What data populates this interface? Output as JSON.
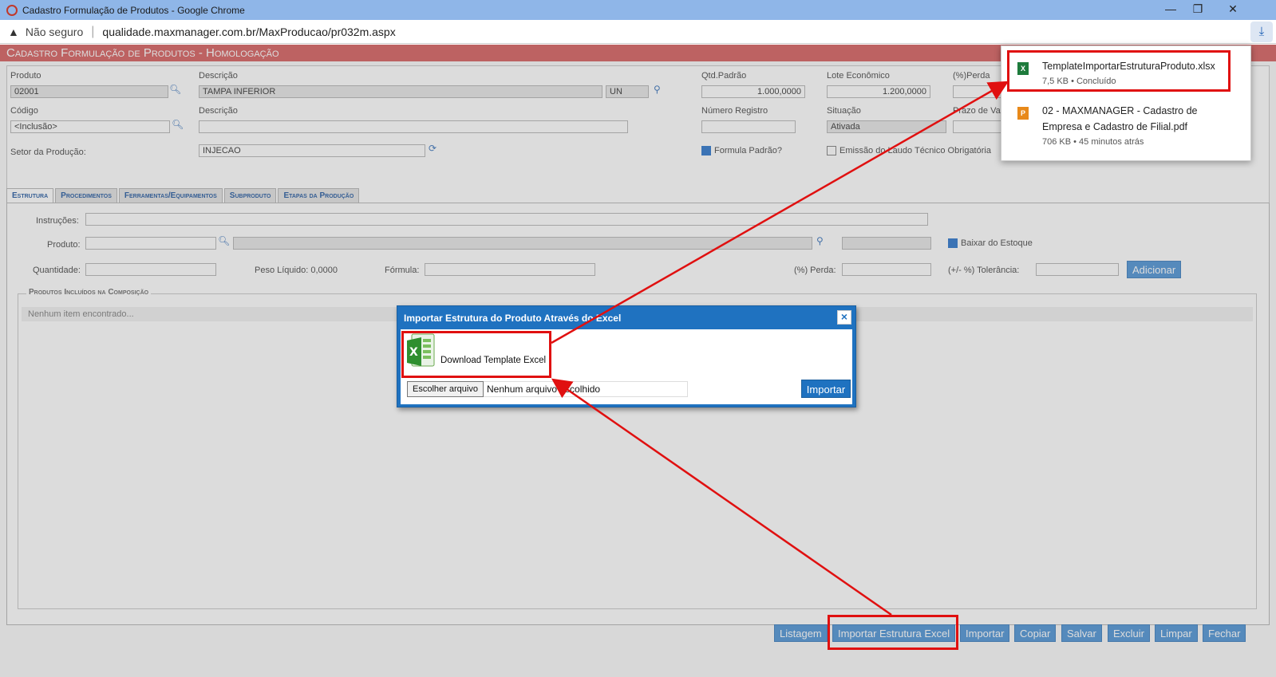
{
  "browser": {
    "window_title": "Cadastro Formulação de Produtos - Google Chrome",
    "security_label": "Não seguro",
    "url": "qualidade.maxmanager.com.br/MaxProducao/pr032m.aspx"
  },
  "page": {
    "title": "Cadastro Formulação de Produtos - Homologação"
  },
  "form": {
    "produto_label": "Produto",
    "produto_value": "02001",
    "descricao_label": "Descrição",
    "descricao_value": "TAMPA INFERIOR",
    "unidade_value": "UN",
    "qtd_padrao_label": "Qtd.Padrão",
    "qtd_padrao_value": "1.000,0000",
    "lote_economico_label": "Lote Econômico",
    "lote_economico_value": "1.200,0000",
    "perda_label": "(%)Perda",
    "codigo_label": "Código",
    "codigo_value": "<Inclusão>",
    "descricao2_label": "Descrição",
    "numero_registro_label": "Número Registro",
    "situacao_label": "Situação",
    "situacao_value": "Ativada",
    "prazo_label": "Prazo de Va",
    "setor_label": "Setor da Produção:",
    "setor_value": "INJECAO",
    "formula_padrao_label": "Formula Padrão?",
    "emissao_laudo_label": "Emissão do Laudo Técnico Obrigatória"
  },
  "tabs": [
    {
      "label": "Estrutura"
    },
    {
      "label": "Procedimentos"
    },
    {
      "label": "Ferramentas/Equipamentos"
    },
    {
      "label": "Subproduto"
    },
    {
      "label": "Etapas da Produção"
    }
  ],
  "estrutura": {
    "instrucoes_label": "Instruções:",
    "produto_label": "Produto:",
    "baixar_estoque_label": "Baixar do Estoque",
    "quantidade_label": "Quantidade:",
    "peso_liquido": "Peso Líquido: 0,0000",
    "formula_label": "Fórmula:",
    "perda_label": "(%) Perda:",
    "tolerancia_label": "(+/- %) Tolerância:",
    "adicionar_label": "Adicionar",
    "produtos_legend": "Produtos Incluídos na Composição",
    "empty_text": "Nenhum item encontrado..."
  },
  "bottom_buttons": [
    {
      "label": "Listagem"
    },
    {
      "label": "Importar Estrutura Excel"
    },
    {
      "label": "Importar"
    },
    {
      "label": "Copiar"
    },
    {
      "label": "Salvar"
    },
    {
      "label": "Excluir"
    },
    {
      "label": "Limpar"
    },
    {
      "label": "Fechar"
    }
  ],
  "downloads": [
    {
      "name": "TemplateImportarEstruturaProduto.xlsx",
      "meta": "7,5 KB • Concluído",
      "icon": "excel-file-icon",
      "color": "#1e7b3c"
    },
    {
      "name_line1": "02 - MAXMANAGER - Cadastro de",
      "name_line2": "Empresa e Cadastro de Filial.pdf",
      "meta": "706 KB • 45 minutos atrás",
      "icon": "pdf-file-icon",
      "color": "#e8891a"
    }
  ],
  "modal": {
    "title": "Importar Estrutura do Produto Através do Excel",
    "close_label": "×",
    "download_template_label": "Download Template Excel",
    "choose_file_label": "Escolher arquivo",
    "no_file_label": "Nenhum arquivo escolhido",
    "import_label": "Importar"
  },
  "colors": {
    "header_red": "#d96b6b",
    "modal_blue": "#1f72c0",
    "button_blue": "#5b9bd8",
    "annotation_red": "#e01010"
  }
}
